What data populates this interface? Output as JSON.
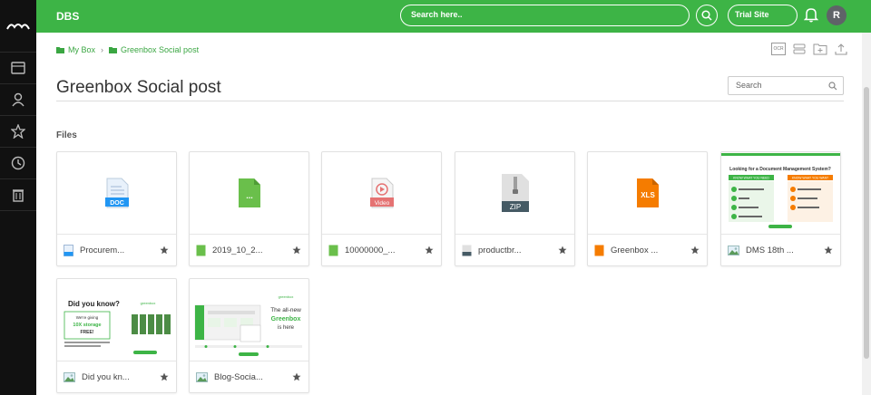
{
  "app": {
    "brand": "DBS"
  },
  "topbar": {
    "search_placeholder": "Search here..",
    "site": "Trial Site",
    "avatar_initial": "R"
  },
  "breadcrumb": [
    "My Box",
    "Greenbox Social post"
  ],
  "toolbar": {
    "ocr_label": "OCR"
  },
  "page": {
    "title": "Greenbox Social post",
    "search_placeholder": "Search",
    "section_label": "Files"
  },
  "files": [
    {
      "name": "Procurem...",
      "type": "doc",
      "icon_label": "DOC",
      "color": "#2196f3"
    },
    {
      "name": "2019_10_2...",
      "type": "generic",
      "icon_label": "...",
      "color": "#6abf4b"
    },
    {
      "name": "10000000_...",
      "type": "video",
      "icon_label": "Video",
      "color": "#e57373"
    },
    {
      "name": "productbr...",
      "type": "zip",
      "icon_label": "ZIP",
      "color": "#455a64"
    },
    {
      "name": "Greenbox ...",
      "type": "xls",
      "icon_label": "XLS",
      "color": "#f57c00"
    },
    {
      "name": "DMS 18th ...",
      "type": "image",
      "preview": "dms"
    },
    {
      "name": "Did you kn...",
      "type": "image",
      "preview": "didyouknow"
    },
    {
      "name": "Blog-Socia...",
      "type": "image",
      "preview": "blog"
    }
  ],
  "previews": {
    "dms": {
      "heading": "Looking for a Document Management System?",
      "left_title": "KNOW WHAT YOU NEED",
      "right_title": "KNOW WHAT YOU WANT"
    },
    "didyouknow": {
      "brand": "greenbox",
      "heading": "Did you know?",
      "line1": "We're giving",
      "line2": "10X storage",
      "line3": "FREE!"
    },
    "blog": {
      "brand": "greenbox",
      "line1": "The all-new",
      "line2": "Greenbox",
      "line3": "is here"
    }
  },
  "colors": {
    "accent": "#3db446",
    "sidebar": "#111111"
  }
}
